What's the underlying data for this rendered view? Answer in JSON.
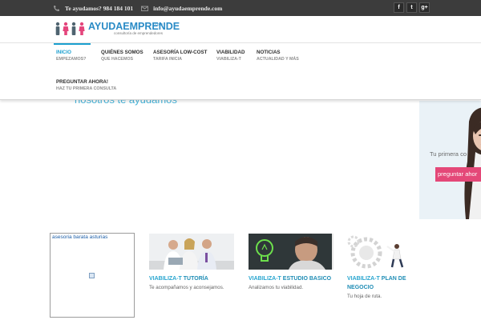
{
  "topbar": {
    "phone_text": "Te ayudamos? 984 184 101",
    "email_text": "info@ayudaemprende.com",
    "social": [
      {
        "icon": "facebook-icon",
        "glyph": "f"
      },
      {
        "icon": "twitter-icon",
        "glyph": "t"
      },
      {
        "icon": "google-plus-icon",
        "glyph": "g+"
      }
    ]
  },
  "logo": {
    "brand": "AYUDAEMPRENDE",
    "domain": ".com",
    "tagline": "consultoría de emprendedores"
  },
  "nav": {
    "items": [
      {
        "title": "INICIO",
        "subtitle": "EMPEZAMOS?",
        "active": true
      },
      {
        "title": "QUIÉNES SOMOS",
        "subtitle": "QUE HACEMOS",
        "active": false
      },
      {
        "title": "ASESORÍA LOW-COST",
        "subtitle": "TARIFA INICIA",
        "active": false
      },
      {
        "title": "VIABILIDAD",
        "subtitle": "VIABILIZA-T",
        "active": false
      },
      {
        "title": "NOTICIAS",
        "subtitle": "ACTUALIDAD Y MÁS",
        "active": false
      },
      {
        "title": "PREGUNTAR AHORA!",
        "subtitle": "HAZ TU PRIMERA CONSULTA",
        "active": false
      }
    ]
  },
  "hero": {
    "text": "nosotros te ayudamos"
  },
  "banner": {
    "copy": "Tu primera co",
    "cta": "preguntar ahor"
  },
  "broken_image": {
    "alt": "asesoria barata asturias"
  },
  "cards": [
    {
      "title_prefix": "VIABILIZA-T ",
      "title_rest": "TUTORÍA",
      "title_line2": "",
      "desc": "Te acompañamos y aconsejamos."
    },
    {
      "title_prefix": "VIABILIZA-T ",
      "title_rest": "ESTUDIO BASICO",
      "title_line2": "",
      "desc": "Analizamos tu viabilidad."
    },
    {
      "title_prefix": "VIABILIZA-T ",
      "title_rest": "PLAN DE",
      "title_line2": "NEGOCIO",
      "desc": "Tu hoja de ruta."
    }
  ],
  "colors": {
    "accent": "#1a9fcf",
    "topbar": "#3c3c3c",
    "cta": "#e44878"
  }
}
